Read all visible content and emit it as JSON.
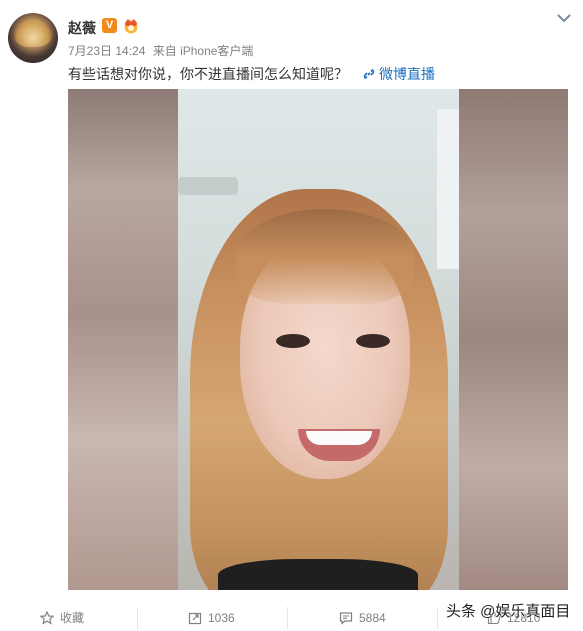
{
  "post": {
    "user_name": "赵薇",
    "verified_badge": "V",
    "date": "7月23日 14:24",
    "source": "来自 iPhone客户端",
    "text": "有些话想对你说，你不进直播间怎么知道呢？",
    "live_link": "微博直播"
  },
  "actions": {
    "favorite": "收藏",
    "repost_count": "1036",
    "comment_count": "5884",
    "like_count": "12810"
  },
  "watermark": "头条 @娱乐真面目",
  "icons": {
    "avatar": "avatar",
    "verified": "verified-v-icon",
    "crown": "crown-badge-icon",
    "menu": "chevron-down-icon",
    "link": "link-icon",
    "favorite": "star-icon",
    "repost": "repost-icon",
    "comment": "comment-icon",
    "like": "thumbs-up-icon"
  },
  "colors": {
    "link": "#1d6fbf",
    "muted": "#808080",
    "badge": "#f08a1d"
  }
}
